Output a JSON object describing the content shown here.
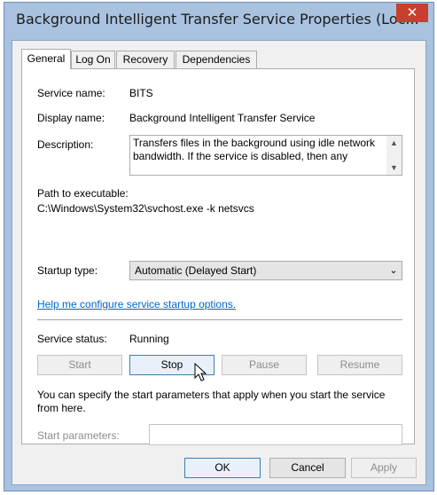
{
  "window": {
    "title": "Background Intelligent Transfer Service Properties (Loc...",
    "close_glyph": "✕"
  },
  "tabs": [
    {
      "label": "General",
      "active": true
    },
    {
      "label": "Log On",
      "active": false
    },
    {
      "label": "Recovery",
      "active": false
    },
    {
      "label": "Dependencies",
      "active": false
    }
  ],
  "general": {
    "service_name_label": "Service name:",
    "service_name_value": "BITS",
    "display_name_label": "Display name:",
    "display_name_value": "Background Intelligent Transfer Service",
    "description_label": "Description:",
    "description_value": "Transfers files in the background using idle network bandwidth. If the service is disabled, then any",
    "path_label": "Path to executable:",
    "path_value": "C:\\Windows\\System32\\svchost.exe -k netsvcs",
    "startup_type_label": "Startup type:",
    "startup_type_value": "Automatic (Delayed Start)",
    "help_link": "Help me configure service startup options.",
    "service_status_label": "Service status:",
    "service_status_value": "Running",
    "buttons": {
      "start": "Start",
      "stop": "Stop",
      "pause": "Pause",
      "resume": "Resume"
    },
    "start_params_note": "You can specify the start parameters that apply when you start the service from here.",
    "start_params_label": "Start parameters:",
    "start_params_value": ""
  },
  "footer": {
    "ok": "OK",
    "cancel": "Cancel",
    "apply": "Apply"
  },
  "colors": {
    "frame": "#a9c2e0",
    "close": "#c7402f",
    "link": "#0066cc"
  }
}
